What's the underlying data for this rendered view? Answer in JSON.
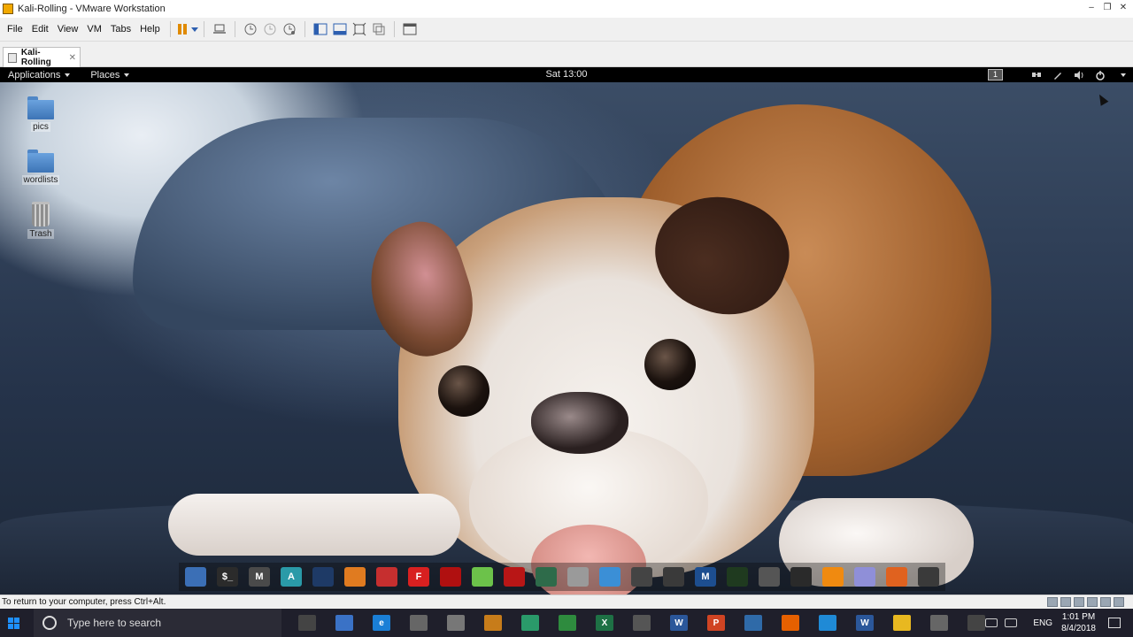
{
  "vmware": {
    "window_title": "Kali-Rolling - VMware Workstation",
    "menu": [
      "File",
      "Edit",
      "View",
      "VM",
      "Tabs",
      "Help"
    ],
    "tab_label": "Kali-Rolling",
    "status_message": "To return to your computer, press Ctrl+Alt."
  },
  "guest": {
    "topbar": {
      "applications_label": "Applications",
      "places_label": "Places",
      "clock": "Sat 13:00",
      "workspace_number": "1"
    },
    "desktop_icons": [
      {
        "label": "pics",
        "icon": "folder-icon"
      },
      {
        "label": "wordlists",
        "icon": "folder-icon"
      },
      {
        "label": "Trash",
        "icon": "trash-icon"
      }
    ],
    "dock": [
      {
        "name": "files",
        "color": "#3b6fb6",
        "glyph": ""
      },
      {
        "name": "terminal",
        "color": "#2b2b2b",
        "glyph": "$_"
      },
      {
        "name": "metasploit",
        "color": "#4a4a4a",
        "glyph": "M"
      },
      {
        "name": "armitage",
        "color": "#2a9aa8",
        "glyph": "A"
      },
      {
        "name": "burpsuite",
        "color": "#1e3a66",
        "glyph": ""
      },
      {
        "name": "beef",
        "color": "#e07b20",
        "glyph": ""
      },
      {
        "name": "faraday",
        "color": "#c62f2f",
        "glyph": ""
      },
      {
        "name": "fern",
        "color": "#d82020",
        "glyph": "F"
      },
      {
        "name": "maltego",
        "color": "#b01010",
        "glyph": ""
      },
      {
        "name": "leafpad",
        "color": "#6cc24a",
        "glyph": ""
      },
      {
        "name": "cherrytree",
        "color": "#b81616",
        "glyph": ""
      },
      {
        "name": "kali-dragon",
        "color": "#2e6b4a",
        "glyph": ""
      },
      {
        "name": "tweaks",
        "color": "#9a9a9a",
        "glyph": ""
      },
      {
        "name": "remote",
        "color": "#3b8fd6",
        "glyph": ""
      },
      {
        "name": "media",
        "color": "#444",
        "glyph": ""
      },
      {
        "name": "tor",
        "color": "#3a3a3a",
        "glyph": ""
      },
      {
        "name": "maltego-m",
        "color": "#1d4e8f",
        "glyph": "M"
      },
      {
        "name": "zenmap",
        "color": "#1f3a1f",
        "glyph": ""
      },
      {
        "name": "search",
        "color": "#555",
        "glyph": ""
      },
      {
        "name": "wireshark-map",
        "color": "#2a2a2a",
        "glyph": ""
      },
      {
        "name": "firefox-orange",
        "color": "#f08a10",
        "glyph": ""
      },
      {
        "name": "notes",
        "color": "#8f8fd8",
        "glyph": ""
      },
      {
        "name": "burp-orange",
        "color": "#e0621f",
        "glyph": ""
      },
      {
        "name": "app-grid",
        "color": "#3a3a3a",
        "glyph": ""
      }
    ]
  },
  "windows": {
    "search_placeholder": "Type here to search",
    "language": "ENG",
    "time": "1:01 PM",
    "date": "8/4/2018",
    "taskbar_apps": [
      {
        "name": "task-view",
        "color": "#444",
        "glyph": ""
      },
      {
        "name": "store",
        "color": "#3a72c6",
        "glyph": ""
      },
      {
        "name": "edge",
        "color": "#1a7fd6",
        "glyph": "e"
      },
      {
        "name": "app-3",
        "color": "#666",
        "glyph": ""
      },
      {
        "name": "app-4",
        "color": "#777",
        "glyph": ""
      },
      {
        "name": "app-5",
        "color": "#c77c1a",
        "glyph": ""
      },
      {
        "name": "app-6",
        "color": "#2a9a6a",
        "glyph": ""
      },
      {
        "name": "chrome",
        "color": "#2e8b3e",
        "glyph": ""
      },
      {
        "name": "excel",
        "color": "#1e7145",
        "glyph": "X"
      },
      {
        "name": "mail",
        "color": "#555",
        "glyph": ""
      },
      {
        "name": "word",
        "color": "#2b579a",
        "glyph": "W"
      },
      {
        "name": "powerpoint",
        "color": "#d04423",
        "glyph": "P"
      },
      {
        "name": "vmware",
        "color": "#2f6aa8",
        "glyph": ""
      },
      {
        "name": "firefox",
        "color": "#e66000",
        "glyph": ""
      },
      {
        "name": "app-14",
        "color": "#1f8ad6",
        "glyph": ""
      },
      {
        "name": "wordpress",
        "color": "#2b579a",
        "glyph": "W"
      },
      {
        "name": "explorer",
        "color": "#e8b820",
        "glyph": ""
      },
      {
        "name": "app-17",
        "color": "#666",
        "glyph": ""
      },
      {
        "name": "app-18",
        "color": "#444",
        "glyph": ""
      }
    ]
  }
}
